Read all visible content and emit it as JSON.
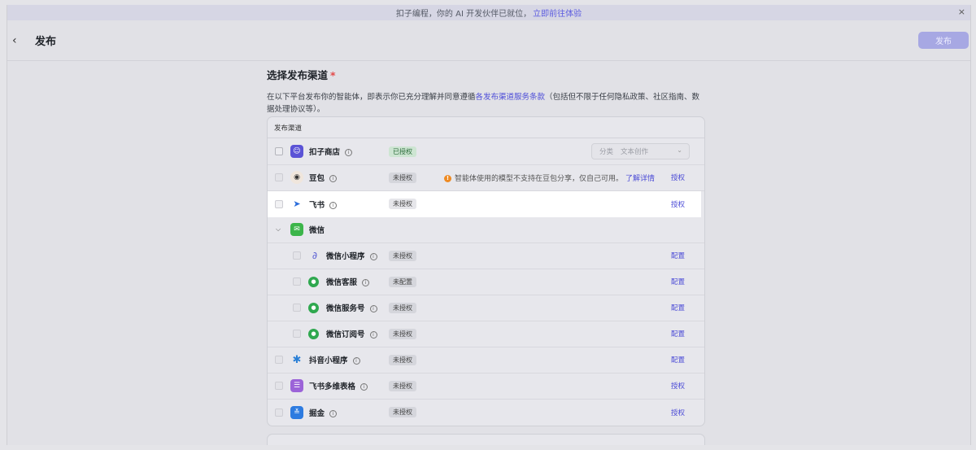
{
  "banner": {
    "text": "扣子编程，你的 AI 开发伙伴已就位，",
    "link": "立即前往体验",
    "close": "×"
  },
  "header": {
    "back": "‹",
    "title": "发布",
    "publish_button": "发布"
  },
  "section": {
    "title": "选择发布渠道",
    "required": "*",
    "desc_prefix": "在以下平台发布你的智能体，即表示你已充分理解并同意遵循",
    "desc_link": "各发布渠道服务条款",
    "desc_suffix": "（包括但不限于任何隐私政策、社区指南、数据处理协议等）。"
  },
  "table": {
    "header": "发布渠道",
    "rows": [
      {
        "name": "扣子商店",
        "status": "已授权",
        "select_label": "分类",
        "select_value": "文本创作"
      },
      {
        "name": "豆包",
        "status": "未授权",
        "warning": "智能体使用的模型不支持在豆包分享，仅自己可用。",
        "warning_link": "了解详情",
        "action": "授权"
      },
      {
        "name": "飞书",
        "status": "未授权",
        "action": "授权"
      },
      {
        "name": "微信"
      },
      {
        "name": "微信小程序",
        "status": "未授权",
        "action": "配置"
      },
      {
        "name": "微信客服",
        "status": "未配置",
        "action": "配置"
      },
      {
        "name": "微信服务号",
        "status": "未授权",
        "action": "配置"
      },
      {
        "name": "微信订阅号",
        "status": "未授权",
        "action": "配置"
      },
      {
        "name": "抖音小程序",
        "status": "未授权",
        "action": "配置"
      },
      {
        "name": "飞书多维表格",
        "status": "未授权",
        "action": "授权"
      },
      {
        "name": "掘金",
        "status": "未授权",
        "action": "授权"
      }
    ]
  },
  "colors": {
    "accent": "#4b4bd6",
    "publish_button": "#a7a8e3",
    "authorized_tag": "#cde5d2",
    "warning": "#ee8a22"
  }
}
